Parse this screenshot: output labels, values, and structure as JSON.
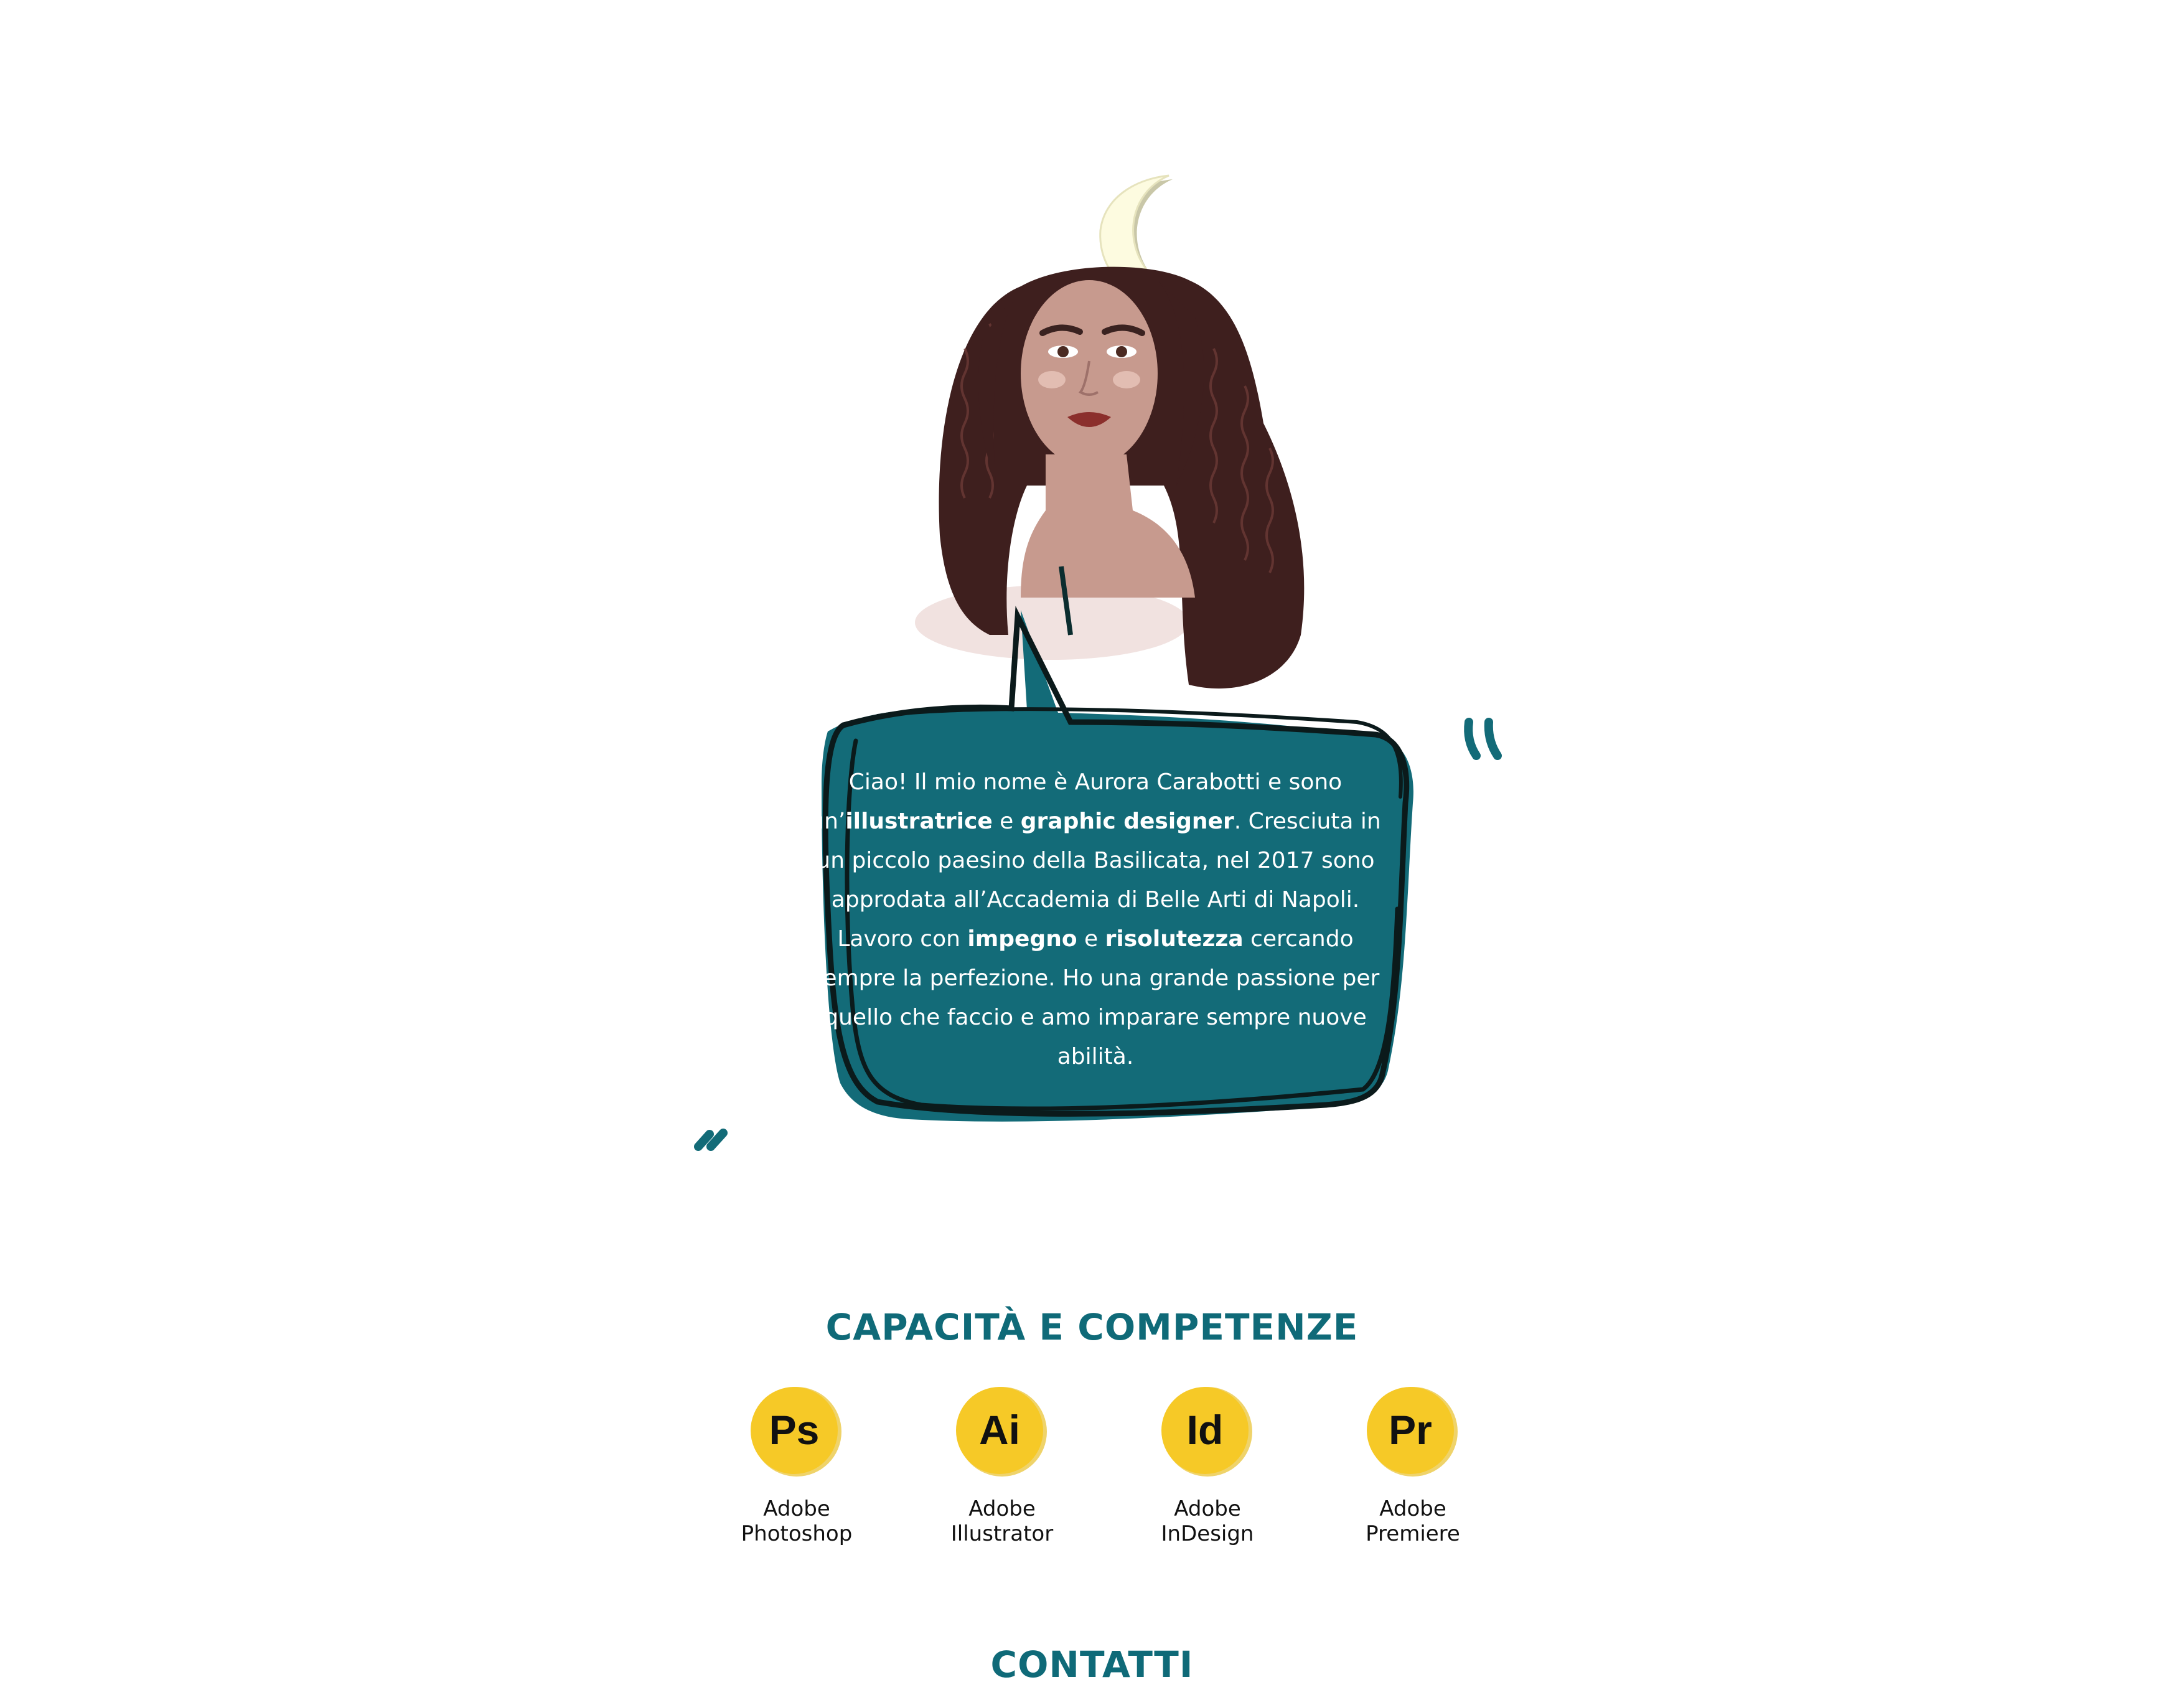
{
  "about": {
    "bio": [
      {
        "text": "Ciao! Il mio nome è Aurora Carabotti e sono un’",
        "bold": false
      },
      {
        "text": "illustratrice",
        "bold": true
      },
      {
        "text": " e ",
        "bold": false
      },
      {
        "text": "graphic designer",
        "bold": true
      },
      {
        "text": ". Cresciuta in un piccolo paesino della Basilicata, nel 2017 sono approdata all’Accademia di Belle Arti di Napoli. Lavoro con ",
        "bold": false
      },
      {
        "text": "impegno",
        "bold": true
      },
      {
        "text": " e ",
        "bold": false
      },
      {
        "text": "risolutezza",
        "bold": true
      },
      {
        "text": " cercando sempre la perfezione. Ho una grande passione per quello che faccio e amo imparare sempre nuove abilità.",
        "bold": false
      }
    ]
  },
  "skills": {
    "title": "CAPACITÀ E COMPETENZE",
    "items": [
      {
        "abbr": "Ps",
        "line1": "Adobe",
        "line2": "Photoshop",
        "icon": "photoshop-icon"
      },
      {
        "abbr": "Ai",
        "line1": "Adobe",
        "line2": "Illustrator",
        "icon": "illustrator-icon"
      },
      {
        "abbr": "Id",
        "line1": "Adobe",
        "line2": "InDesign",
        "icon": "indesign-icon"
      },
      {
        "abbr": "Pr",
        "line1": "Adobe",
        "line2": "Premiere",
        "icon": "premiere-icon"
      }
    ]
  },
  "contacts": {
    "title": "CONTATTI"
  },
  "colors": {
    "teal": "#136b78",
    "skill_yellow": "#f6c927",
    "moon": "#fdfbe0",
    "hair": "#3e1f1e",
    "skin": "#c79a8e"
  }
}
